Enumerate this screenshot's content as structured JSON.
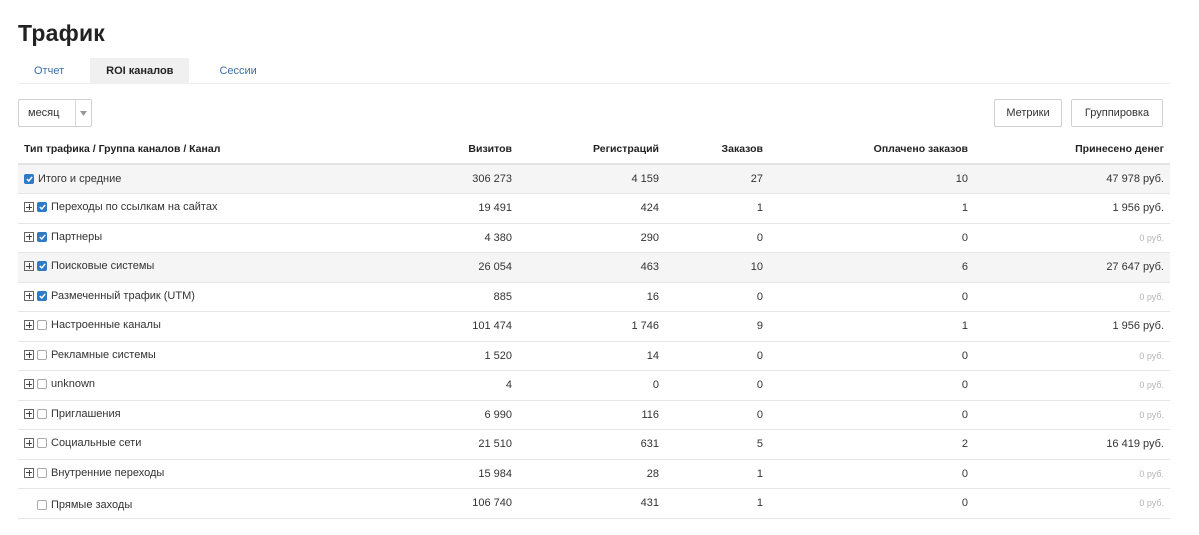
{
  "header": {
    "title": "Трафик"
  },
  "tabs": [
    {
      "label": "Отчет",
      "active": false
    },
    {
      "label": "ROI каналов",
      "active": true
    },
    {
      "label": "Сессии",
      "active": false
    }
  ],
  "toolbar": {
    "period_value": "месяц",
    "metrics_label": "Метрики",
    "grouping_label": "Группировка"
  },
  "table": {
    "columns": [
      "Тип трафика / Группа каналов / Канал",
      "Визитов",
      "Регистраций",
      "Заказов",
      "Оплачено заказов",
      "Принесено денег"
    ],
    "rows": [
      {
        "name": "Итого и средние",
        "expandable": false,
        "checked": true,
        "shaded": true,
        "visits": "306 273",
        "registrations": "4 159",
        "orders": "27",
        "paid": "10",
        "money": "47 978 руб.",
        "zero_money": false
      },
      {
        "name": "Переходы по ссылкам на сайтах",
        "expandable": true,
        "checked": true,
        "shaded": false,
        "visits": "19 491",
        "registrations": "424",
        "orders": "1",
        "paid": "1",
        "money": "1 956 руб.",
        "zero_money": false
      },
      {
        "name": "Партнеры",
        "expandable": true,
        "checked": true,
        "shaded": false,
        "visits": "4 380",
        "registrations": "290",
        "orders": "0",
        "paid": "0",
        "money": "0 руб.",
        "zero_money": true
      },
      {
        "name": "Поисковые системы",
        "expandable": true,
        "checked": true,
        "shaded": true,
        "visits": "26 054",
        "registrations": "463",
        "orders": "10",
        "paid": "6",
        "money": "27 647 руб.",
        "zero_money": false
      },
      {
        "name": "Размеченный трафик (UTM)",
        "expandable": true,
        "checked": true,
        "shaded": false,
        "visits": "885",
        "registrations": "16",
        "orders": "0",
        "paid": "0",
        "money": "0 руб.",
        "zero_money": true
      },
      {
        "name": "Настроенные каналы",
        "expandable": true,
        "checked": false,
        "shaded": false,
        "visits": "101 474",
        "registrations": "1 746",
        "orders": "9",
        "paid": "1",
        "money": "1 956 руб.",
        "zero_money": false
      },
      {
        "name": "Рекламные системы",
        "expandable": true,
        "checked": false,
        "shaded": false,
        "visits": "1 520",
        "registrations": "14",
        "orders": "0",
        "paid": "0",
        "money": "0 руб.",
        "zero_money": true
      },
      {
        "name": "unknown",
        "expandable": true,
        "checked": false,
        "shaded": false,
        "visits": "4",
        "registrations": "0",
        "orders": "0",
        "paid": "0",
        "money": "0 руб.",
        "zero_money": true
      },
      {
        "name": "Приглашения",
        "expandable": true,
        "checked": false,
        "shaded": false,
        "visits": "6 990",
        "registrations": "116",
        "orders": "0",
        "paid": "0",
        "money": "0 руб.",
        "zero_money": true
      },
      {
        "name": "Социальные сети",
        "expandable": true,
        "checked": false,
        "shaded": false,
        "visits": "21 510",
        "registrations": "631",
        "orders": "5",
        "paid": "2",
        "money": "16 419 руб.",
        "zero_money": false
      },
      {
        "name": "Внутренние переходы",
        "expandable": true,
        "checked": false,
        "shaded": false,
        "visits": "15 984",
        "registrations": "28",
        "orders": "1",
        "paid": "0",
        "money": "0 руб.",
        "zero_money": true
      },
      {
        "name": "Прямые заходы",
        "expandable": false,
        "checked": false,
        "shaded": false,
        "visits": "106 740",
        "registrations": "431",
        "orders": "1",
        "paid": "0",
        "money": "0 руб.",
        "zero_money": true
      }
    ]
  },
  "colors": {
    "accent": "#2e7ac4",
    "link": "#3c6fa8",
    "muted": "#b5b5b5",
    "row_shade": "#f5f5f5"
  },
  "icons": {
    "expand": "plus-box-icon",
    "checkbox": "checkbox-icon",
    "dropdown": "caret-down-icon"
  }
}
